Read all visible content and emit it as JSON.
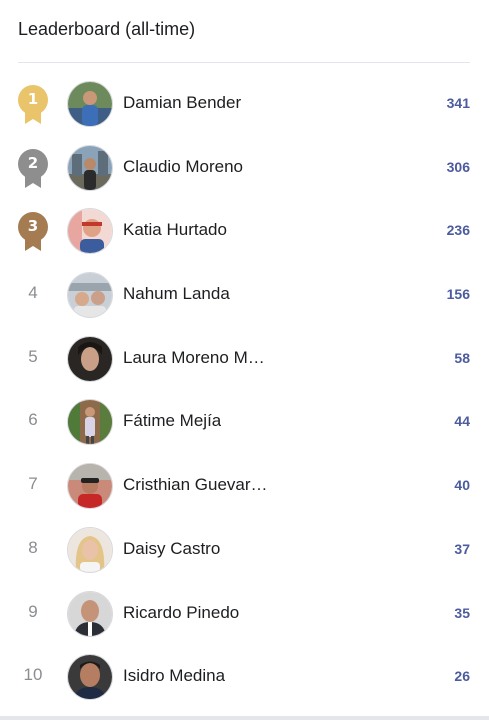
{
  "header": {
    "title": "Leaderboard (all-time)"
  },
  "colors": {
    "gold": "#e9c46a",
    "silver": "#8e8e8e",
    "bronze": "#a57c52",
    "score": "#4b5b9e"
  },
  "leaders": [
    {
      "rank": "1",
      "name": "Damian Bender",
      "score": "341",
      "medal": "gold"
    },
    {
      "rank": "2",
      "name": "Claudio Moreno",
      "score": "306",
      "medal": "silver"
    },
    {
      "rank": "3",
      "name": "Katia Hurtado",
      "score": "236",
      "medal": "bronze"
    },
    {
      "rank": "4",
      "name": "Nahum Landa",
      "score": "156"
    },
    {
      "rank": "5",
      "name": "Laura Moreno M…",
      "score": "58"
    },
    {
      "rank": "6",
      "name": "Fátime Mejía",
      "score": "44"
    },
    {
      "rank": "7",
      "name": "Cristhian Guevar…",
      "score": "40"
    },
    {
      "rank": "8",
      "name": "Daisy Castro",
      "score": "37"
    },
    {
      "rank": "9",
      "name": "Ricardo Pinedo",
      "score": "35"
    },
    {
      "rank": "10",
      "name": "Isidro Medina",
      "score": "26"
    }
  ]
}
